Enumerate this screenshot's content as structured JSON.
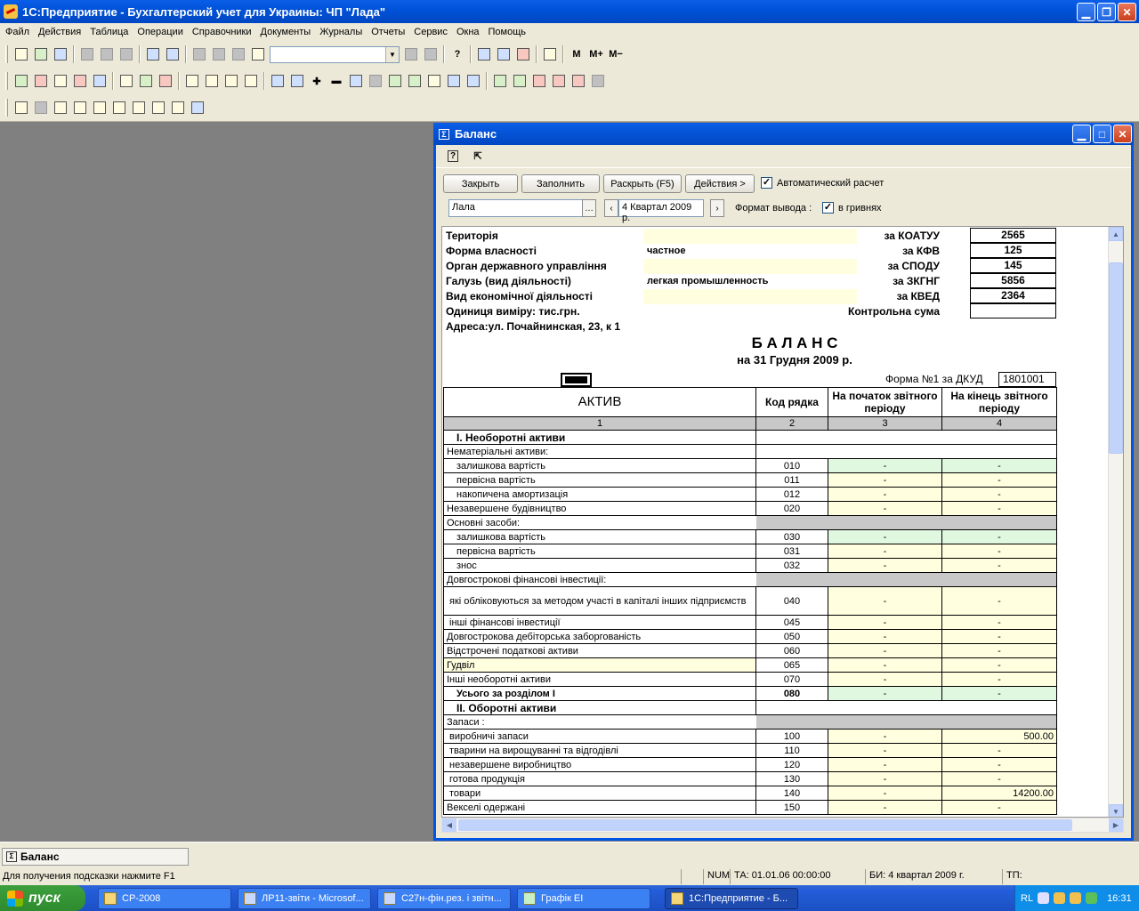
{
  "app": {
    "title": "1С:Предприятие - Бухгалтерский учет для Украины: ЧП \"Лада\""
  },
  "menu": [
    "Файл",
    "Действия",
    "Таблица",
    "Операции",
    "Справочники",
    "Документы",
    "Журналы",
    "Отчеты",
    "Сервис",
    "Окна",
    "Помощь"
  ],
  "toolbar": {
    "text_buttons": [
      "M",
      "M+",
      "M−"
    ],
    "icons": [
      "new-document-icon",
      "open-folder-icon",
      "save-icon",
      "cut-icon",
      "copy-icon",
      "paste-icon",
      "print-icon",
      "print-preview-icon",
      "undo-icon",
      "redo-icon",
      "find-icon",
      "help-icon",
      "calculator-icon",
      "calendar-icon"
    ]
  },
  "child_window": {
    "title": "Баланс",
    "buttons": {
      "close": "Закрыть",
      "fill": "Заполнить",
      "expand": "Раскрыть (F5)",
      "actions": "Действия >"
    },
    "auto_calc_label": "Автоматический расчет",
    "auto_calc_checked": true,
    "company": "Лала",
    "period": "4 Квартал 2009 р.",
    "output_format_label": "Формат вывода :",
    "in_uah_label": "в гривнях",
    "in_uah_checked": true
  },
  "report": {
    "info": [
      {
        "label": "Територія",
        "value": "",
        "code_label": "за КОАТУУ",
        "code": "2565"
      },
      {
        "label": "Форма власності",
        "value": "частное",
        "code_label": "за КФВ",
        "code": "125"
      },
      {
        "label": "Орган державного управління",
        "value": "",
        "code_label": "за СПОДУ",
        "code": "145"
      },
      {
        "label": "Галузь (вид діяльності)",
        "value": "легкая промышленность",
        "code_label": "за ЗКГНГ",
        "code": "5856"
      },
      {
        "label": "Вид економічної діяльності",
        "value": "",
        "code_label": "за КВЕД",
        "code": "2364"
      },
      {
        "label": "Одиниця виміру: тис.грн.",
        "value": "",
        "code_label": "Контрольна сума",
        "code": ""
      }
    ],
    "address": "Адреса:ул. Почайнинская, 23, к 1",
    "title": "Б А Л А Н С",
    "date": "на 31 Грудня 2009 р.",
    "forma_label": "Форма №1 за ДКУД",
    "forma_code": "1801001",
    "headers": {
      "aktiv": "АКТИВ",
      "code": "Код рядка",
      "start": "На початок звітного періоду",
      "end": "На кінець звітного періоду"
    },
    "col_numbers": [
      "1",
      "2",
      "3",
      "4"
    ],
    "sections": {
      "s1": "I. Необоротні  активи",
      "s2": "II. Оборотні активи"
    },
    "rows": [
      {
        "label": "Нематеріальні активи:",
        "type": "plain"
      },
      {
        "label": "залишкова вартість",
        "code": "010",
        "start": "-",
        "end": "-",
        "type": "ind",
        "green": true
      },
      {
        "label": "первісна вартість",
        "code": "011",
        "start": "-",
        "end": "-",
        "type": "ind"
      },
      {
        "label": "накопичена амортизація",
        "code": "012",
        "start": "-",
        "end": "-",
        "type": "ind"
      },
      {
        "label": "Незавершене будівництво",
        "code": "020",
        "start": "-",
        "end": "-",
        "type": "plain"
      },
      {
        "label": "Основні засоби:",
        "type": "grp"
      },
      {
        "label": "залишкова вартість",
        "code": "030",
        "start": "-",
        "end": "-",
        "type": "ind",
        "green": true
      },
      {
        "label": "первісна вартість",
        "code": "031",
        "start": "-",
        "end": "-",
        "type": "ind"
      },
      {
        "label": "знос",
        "code": "032",
        "start": "-",
        "end": "-",
        "type": "ind"
      },
      {
        "label": "Довгострокові фінансові інвестиції:",
        "type": "grp"
      },
      {
        "label": "які обліковуються за методом участі в капіталі інших підприємств",
        "code": "040",
        "start": "-",
        "end": "-",
        "type": "tall"
      },
      {
        "label": "інші фінансові інвестиції",
        "code": "045",
        "start": "-",
        "end": "-",
        "type": "ind2"
      },
      {
        "label": "Довгострокова дебіторська заборгованість",
        "code": "050",
        "start": "-",
        "end": "-",
        "type": "plain"
      },
      {
        "label": "Відстрочені податкові активи",
        "code": "060",
        "start": "-",
        "end": "-",
        "type": "plain"
      },
      {
        "label": "Гудвіл",
        "code": "065",
        "start": "-",
        "end": "-",
        "type": "yel"
      },
      {
        "label": "Інші необоротні активи",
        "code": "070",
        "start": "-",
        "end": "-",
        "type": "plain"
      },
      {
        "label": "Усього за розділом I",
        "code": "080",
        "start": "-",
        "end": "-",
        "type": "total",
        "green": true
      }
    ],
    "rows2": [
      {
        "label": "Запаси :",
        "type": "grp"
      },
      {
        "label": "виробничі запаси",
        "code": "100",
        "start": "-",
        "end": "500.00",
        "type": "ind2"
      },
      {
        "label": "тварини на вирощуванні та відгодівлі",
        "code": "110",
        "start": "-",
        "end": "-",
        "type": "ind2"
      },
      {
        "label": "незавершене виробництво",
        "code": "120",
        "start": "-",
        "end": "-",
        "type": "ind2"
      },
      {
        "label": "готова  продукція",
        "code": "130",
        "start": "-",
        "end": "-",
        "type": "ind2"
      },
      {
        "label": "товари",
        "code": "140",
        "start": "-",
        "end": "14200.00",
        "type": "ind2"
      },
      {
        "label": "Векселі одержані",
        "code": "150",
        "start": "-",
        "end": "-",
        "type": "plain"
      }
    ]
  },
  "window_bar": {
    "tab": "Баланс"
  },
  "status": {
    "hint": "Для получения подсказки нажмите F1",
    "num": "NUM",
    "ta": "ТА: 01.01.06  00:00:00",
    "bi": "БИ: 4 квартал 2009 г.",
    "tp": "ТП:"
  },
  "taskbar": {
    "start": "пуск",
    "tasks": [
      "СР-2008",
      "ЛР11-звіти - Microsof...",
      "С27н-фін.рез. і звітн...",
      "Графік ЕІ",
      "1С:Предприятие - Б..."
    ],
    "lang": "RL",
    "clock": "16:31"
  }
}
